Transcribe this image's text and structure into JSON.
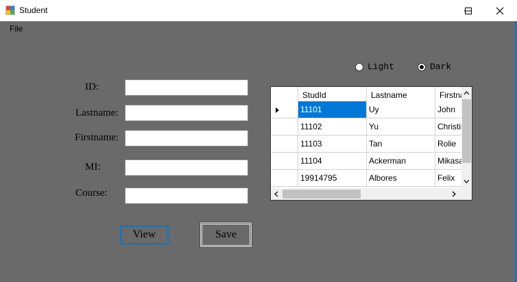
{
  "window": {
    "title": "Student"
  },
  "menu": {
    "file": "File"
  },
  "form": {
    "id_label": "ID:",
    "lastname_label": "Lastname:",
    "firstname_label": "Firstname:",
    "mi_label": "MI:",
    "course_label": "Course:",
    "id_value": "",
    "lastname_value": "",
    "firstname_value": "",
    "mi_value": "",
    "course_value": ""
  },
  "buttons": {
    "view": "View",
    "save": "Save"
  },
  "theme": {
    "light": "Light",
    "dark": "Dark",
    "selected": "Dark"
  },
  "grid": {
    "columns": [
      "StudId",
      "Lastname",
      "Firstna"
    ],
    "rows": [
      [
        "11101",
        "Uy",
        "John"
      ],
      [
        "11102",
        "Yu",
        "Christin"
      ],
      [
        "11103",
        "Tan",
        "Rolie"
      ],
      [
        "11104",
        "Ackerman",
        "Mikasa"
      ],
      [
        "19914795",
        "Albores",
        "Felix"
      ]
    ],
    "selected_row": 0
  },
  "colors": {
    "background": "#6a6a6a",
    "selection": "#0078d7",
    "view_border": "#0078d7"
  }
}
